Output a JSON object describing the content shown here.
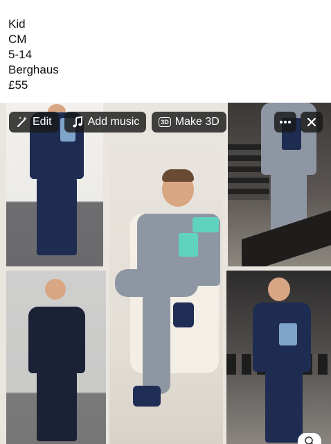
{
  "post": {
    "lines": [
      "Kid",
      "CM",
      "5-14",
      "Berghaus",
      "£55"
    ]
  },
  "toolbar": {
    "edit_label": "Edit",
    "add_music_label": "Add music",
    "make3d_label": "Make 3D",
    "make3d_badge": "3D"
  },
  "icons": {
    "edit": "magic-wand-icon",
    "music": "music-note-icon",
    "more": "more-dots-icon",
    "close": "close-icon",
    "search": "search-icon"
  },
  "colors": {
    "pill_bg": "#181818",
    "navy": "#1e2c52",
    "grey": "#8f96a3",
    "mint": "#5fd3be",
    "light_blue": "#7fa4c9"
  }
}
